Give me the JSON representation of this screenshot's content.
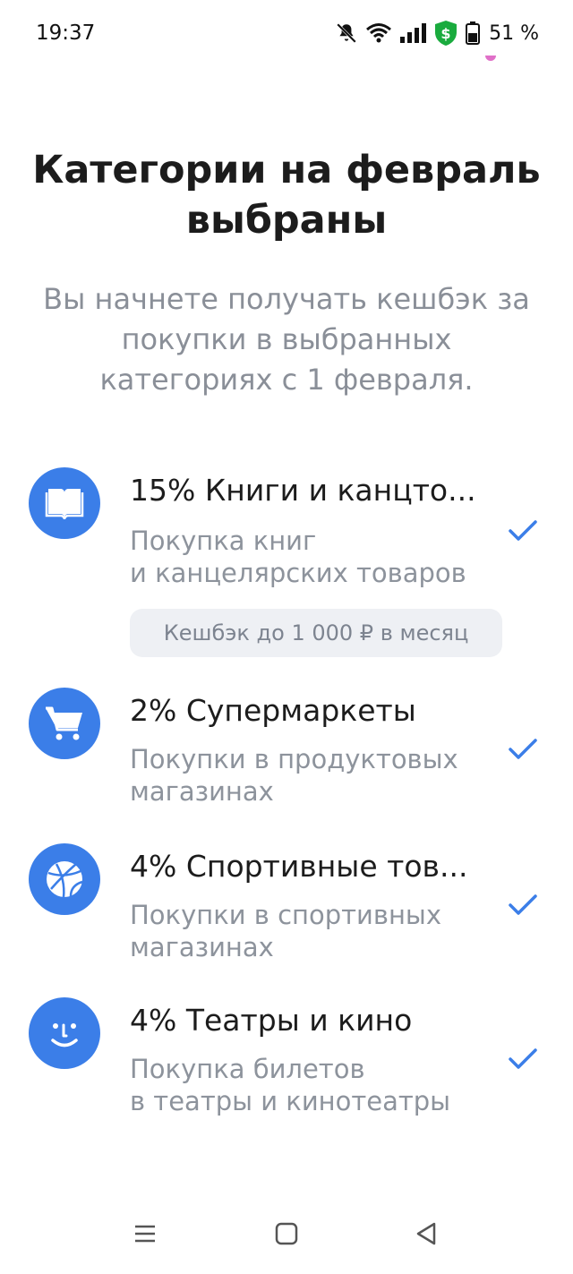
{
  "status_bar": {
    "time": "19:37",
    "battery": "51 %",
    "icons": [
      "bell-off-icon",
      "wifi-icon",
      "signal-icon",
      "shield-dollar-icon",
      "battery-icon"
    ]
  },
  "header": {
    "title": "Категории на февраль выбраны",
    "subtitle": "Вы начнете получать кешбэк за покупки в выбранных категориях с 1 февраля."
  },
  "categories": [
    {
      "title": "15% Книги и канцто...",
      "desc_line1": "Покупка книг",
      "desc_line2": "и канцелярских товаров",
      "badge": "Кешбэк до 1 000 ₽ в месяц",
      "icon": "book-icon",
      "checked": true
    },
    {
      "title": "2% Супермаркеты",
      "desc_line1": "Покупки в продуктовых",
      "desc_line2": "магазинах",
      "icon": "cart-icon",
      "checked": true
    },
    {
      "title": "4% Спортивные тов...",
      "desc_line1": "Покупки в спортивных",
      "desc_line2": "магазинах",
      "icon": "ball-icon",
      "checked": true
    },
    {
      "title": "4% Театры и кино",
      "desc_line1": "Покупка билетов",
      "desc_line2": "в театры и кинотеатры",
      "icon": "smile-icon",
      "checked": true
    }
  ],
  "colors": {
    "accent": "#3b7ee8",
    "title_text": "#1c1c1c",
    "secondary_text": "#8d939c",
    "badge_bg": "#eef0f4"
  },
  "nav_bar": [
    "menu-icon",
    "home-icon",
    "back-icon"
  ]
}
